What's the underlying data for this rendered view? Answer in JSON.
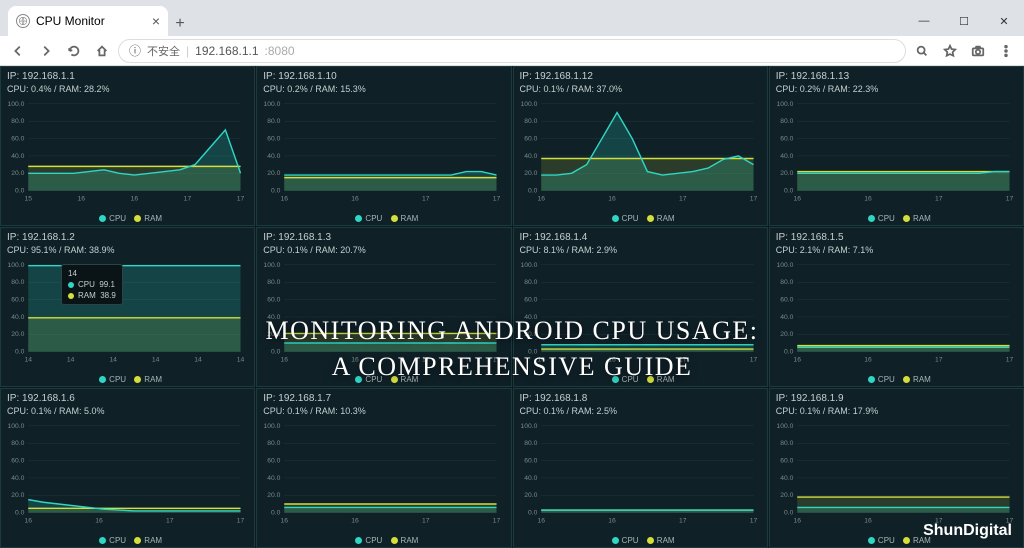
{
  "browser": {
    "tab_title": "CPU Monitor",
    "close_glyph": "×",
    "newtab_glyph": "+",
    "insecure_label": "不安全",
    "url_host": "192.168.1.1",
    "url_port": ":8080",
    "win_min": "—",
    "win_max": "☐",
    "win_close": "✕"
  },
  "legend": {
    "cpu": "CPU",
    "ram": "RAM"
  },
  "overlay": {
    "line1": "MONITORING ANDROID CPU USAGE:",
    "line2": "A COMPREHENSIVE GUIDE"
  },
  "watermark": "ShunDigital",
  "tooltip": {
    "panel_index": 4,
    "time": "14",
    "cpu_label": "CPU",
    "cpu_value": "99.1",
    "ram_label": "RAM",
    "ram_value": "38.9"
  },
  "colors": {
    "cpu": "#2fd6c4",
    "ram": "#d4df3b"
  },
  "chart_data": [
    {
      "ip": "IP: 192.168.1.1",
      "stat": "CPU: 0.4% / RAM: 28.2%",
      "ylim": [
        0,
        100
      ],
      "xticks": [
        "15",
        "16",
        "16",
        "17",
        "17"
      ],
      "cpu": [
        20,
        20,
        20,
        20,
        22,
        24,
        20,
        18,
        20,
        22,
        24,
        30,
        50,
        70,
        20
      ],
      "ram": [
        28,
        28,
        28,
        28,
        28,
        28,
        28,
        28,
        28,
        28,
        28,
        28,
        28,
        28,
        28
      ]
    },
    {
      "ip": "IP: 192.168.1.10",
      "stat": "CPU: 0.2% / RAM: 15.3%",
      "ylim": [
        0,
        100
      ],
      "xticks": [
        "16",
        "16",
        "17",
        "17"
      ],
      "cpu": [
        18,
        18,
        18,
        18,
        18,
        18,
        18,
        18,
        18,
        18,
        18,
        18,
        22,
        22,
        18
      ],
      "ram": [
        15,
        15,
        15,
        15,
        15,
        15,
        15,
        15,
        15,
        15,
        15,
        15,
        15,
        15,
        15
      ]
    },
    {
      "ip": "IP: 192.168.1.12",
      "stat": "CPU: 0.1% / RAM: 37.0%",
      "ylim": [
        0,
        100
      ],
      "xticks": [
        "16",
        "16",
        "17",
        "17"
      ],
      "cpu": [
        18,
        18,
        20,
        30,
        60,
        90,
        60,
        22,
        18,
        20,
        22,
        26,
        36,
        40,
        30
      ],
      "ram": [
        37,
        37,
        37,
        37,
        37,
        37,
        37,
        37,
        37,
        37,
        37,
        37,
        37,
        37,
        37
      ]
    },
    {
      "ip": "IP: 192.168.1.13",
      "stat": "CPU: 0.2% / RAM: 22.3%",
      "ylim": [
        0,
        100
      ],
      "xticks": [
        "16",
        "16",
        "17",
        "17"
      ],
      "cpu": [
        20,
        20,
        20,
        20,
        20,
        20,
        20,
        20,
        20,
        20,
        20,
        20,
        20,
        22,
        22
      ],
      "ram": [
        22,
        22,
        22,
        22,
        22,
        22,
        22,
        22,
        22,
        22,
        22,
        22,
        22,
        22,
        22
      ]
    },
    {
      "ip": "IP: 192.168.1.2",
      "stat": "CPU: 95.1% / RAM: 38.9%",
      "ylim": [
        0,
        100
      ],
      "xticks": [
        "14",
        "14",
        "14",
        "14",
        "14",
        "14"
      ],
      "cpu": [
        99,
        99,
        99,
        99,
        99,
        99,
        99,
        99,
        99,
        99,
        99,
        99,
        99,
        99,
        99
      ],
      "ram": [
        39,
        39,
        39,
        39,
        39,
        39,
        39,
        39,
        39,
        39,
        39,
        39,
        39,
        39,
        39
      ]
    },
    {
      "ip": "IP: 192.168.1.3",
      "stat": "CPU: 0.1% / RAM: 20.7%",
      "ylim": [
        0,
        100
      ],
      "xticks": [
        "16",
        "16",
        "17",
        "17"
      ],
      "cpu": [
        10,
        10,
        10,
        10,
        10,
        10,
        10,
        10,
        10,
        10,
        10,
        10,
        10,
        10,
        10
      ],
      "ram": [
        21,
        21,
        21,
        21,
        21,
        21,
        21,
        21,
        21,
        21,
        21,
        21,
        21,
        21,
        21
      ]
    },
    {
      "ip": "IP: 192.168.1.4",
      "stat": "CPU: 8.1% / RAM: 2.9%",
      "ylim": [
        0,
        100
      ],
      "xticks": [
        "16",
        "16",
        "17",
        "17"
      ],
      "cpu": [
        8,
        8,
        8,
        8,
        8,
        8,
        8,
        8,
        8,
        8,
        8,
        8,
        8,
        8,
        8
      ],
      "ram": [
        3,
        3,
        3,
        3,
        3,
        3,
        3,
        3,
        3,
        3,
        3,
        3,
        3,
        3,
        3
      ]
    },
    {
      "ip": "IP: 192.168.1.5",
      "stat": "CPU: 2.1% / RAM: 7.1%",
      "ylim": [
        0,
        100
      ],
      "xticks": [
        "16",
        "16",
        "17",
        "17"
      ],
      "cpu": [
        5,
        5,
        5,
        5,
        5,
        5,
        5,
        5,
        5,
        5,
        5,
        5,
        5,
        5,
        5
      ],
      "ram": [
        7,
        7,
        7,
        7,
        7,
        7,
        7,
        7,
        7,
        7,
        7,
        7,
        7,
        7,
        7
      ]
    },
    {
      "ip": "IP: 192.168.1.6",
      "stat": "CPU: 0.1% / RAM: 5.0%",
      "ylim": [
        0,
        100
      ],
      "xticks": [
        "16",
        "16",
        "17",
        "17"
      ],
      "cpu": [
        15,
        12,
        10,
        8,
        6,
        4,
        3,
        2,
        2,
        2,
        2,
        2,
        2,
        2,
        2
      ],
      "ram": [
        5,
        5,
        5,
        5,
        5,
        5,
        5,
        5,
        5,
        5,
        5,
        5,
        5,
        5,
        5
      ]
    },
    {
      "ip": "IP: 192.168.1.7",
      "stat": "CPU: 0.1% / RAM: 10.3%",
      "ylim": [
        0,
        100
      ],
      "xticks": [
        "16",
        "16",
        "17",
        "17"
      ],
      "cpu": [
        6,
        6,
        6,
        6,
        6,
        6,
        6,
        6,
        6,
        6,
        6,
        6,
        6,
        6,
        6
      ],
      "ram": [
        10,
        10,
        10,
        10,
        10,
        10,
        10,
        10,
        10,
        10,
        10,
        10,
        10,
        10,
        10
      ]
    },
    {
      "ip": "IP: 192.168.1.8",
      "stat": "CPU: 0.1% / RAM: 2.5%",
      "ylim": [
        0,
        100
      ],
      "xticks": [
        "16",
        "16",
        "17",
        "17"
      ],
      "cpu": [
        3,
        3,
        3,
        3,
        3,
        3,
        3,
        3,
        3,
        3,
        3,
        3,
        3,
        3,
        3
      ],
      "ram": [
        3,
        3,
        3,
        3,
        3,
        3,
        3,
        3,
        3,
        3,
        3,
        3,
        3,
        3,
        3
      ]
    },
    {
      "ip": "IP: 192.168.1.9",
      "stat": "CPU: 0.1% / RAM: 17.9%",
      "ylim": [
        0,
        100
      ],
      "xticks": [
        "16",
        "16",
        "17",
        "17"
      ],
      "cpu": [
        6,
        6,
        6,
        6,
        6,
        6,
        6,
        6,
        6,
        6,
        6,
        6,
        6,
        6,
        6
      ],
      "ram": [
        18,
        18,
        18,
        18,
        18,
        18,
        18,
        18,
        18,
        18,
        18,
        18,
        18,
        18,
        18
      ]
    }
  ]
}
